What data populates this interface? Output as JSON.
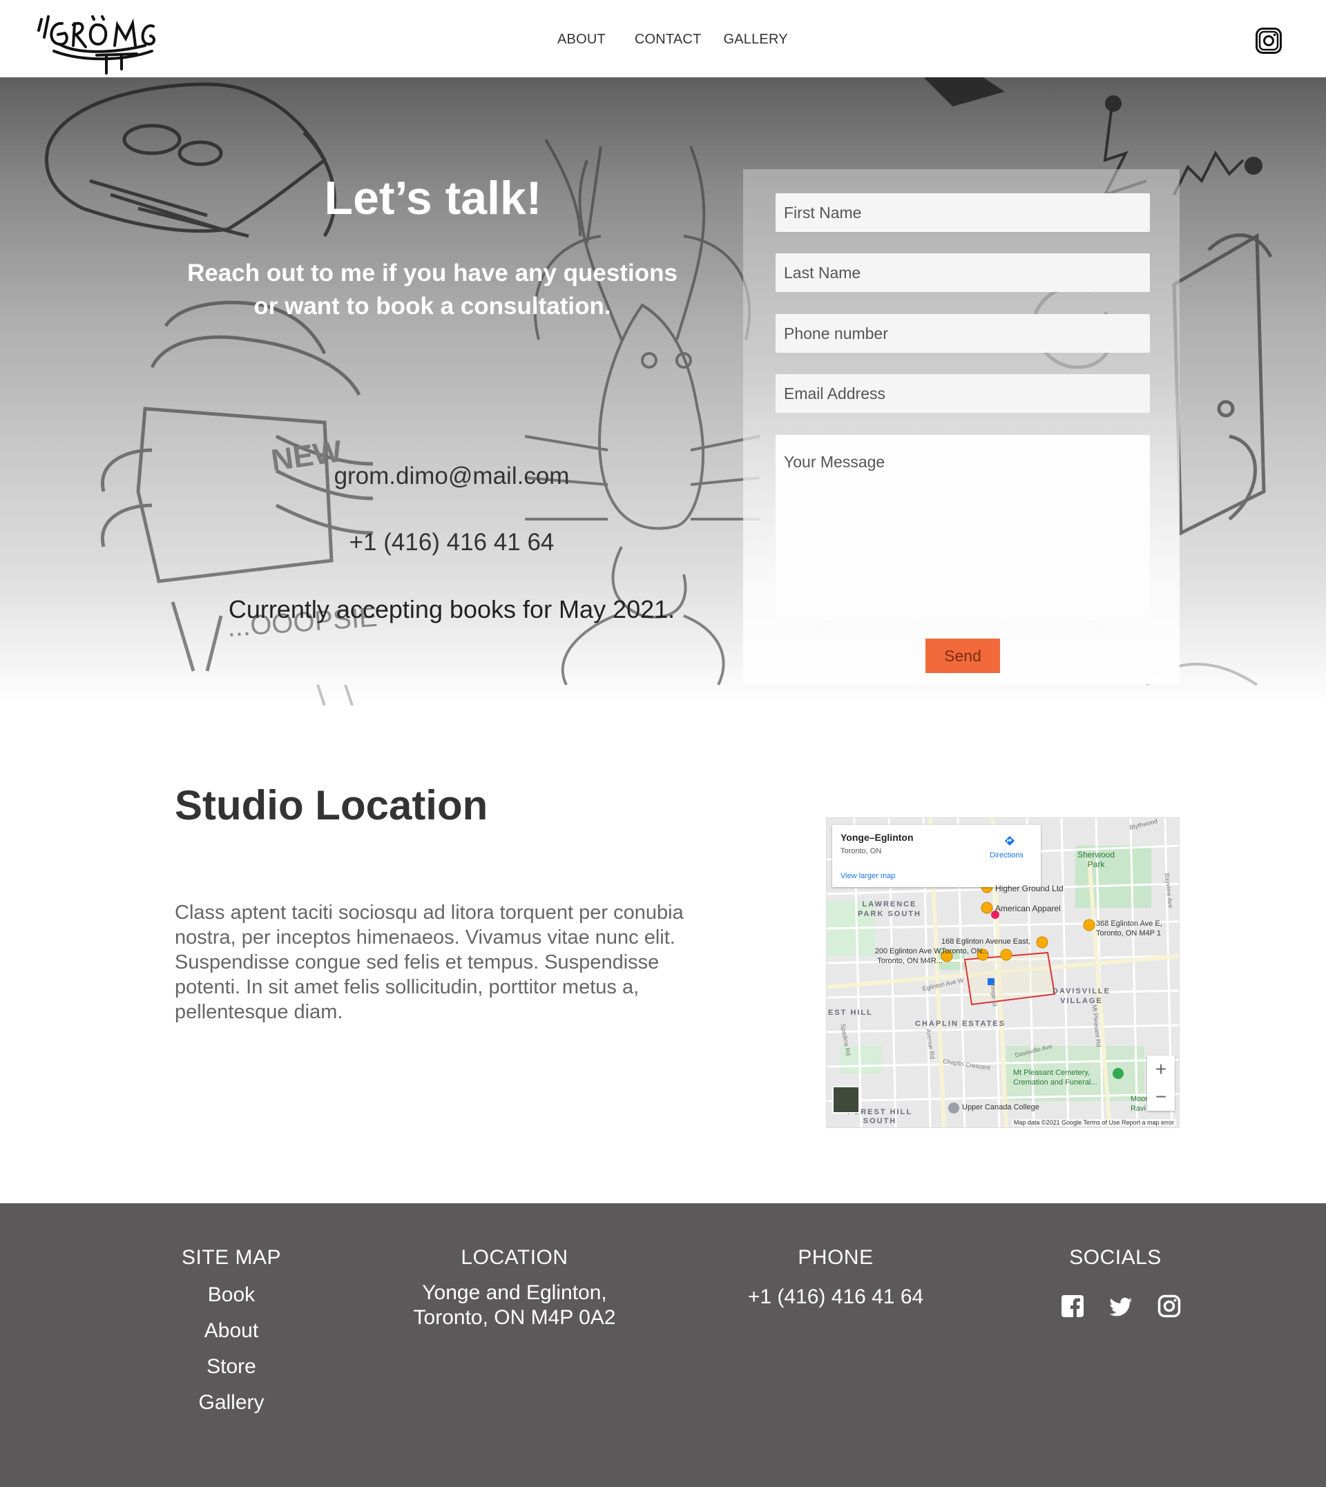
{
  "nav": {
    "logo_alt": "GROMG",
    "links": [
      "ABOUT",
      "CONTACT",
      "GALLERY"
    ],
    "instagram_icon": "instagram-icon"
  },
  "hero": {
    "title": "Let’s talk!",
    "subtitle": "Reach out to me if you have any questions or want to book a consultation.",
    "email": "grom.dimo@mail.com",
    "phone": "+1 (416) 416 41 64",
    "note": "Currently accepting books for May 2021."
  },
  "form": {
    "first_name_placeholder": "First Name",
    "last_name_placeholder": "Last Name",
    "phone_placeholder": "Phone number",
    "email_placeholder": "Email Address",
    "message_placeholder": "Your Message",
    "send_label": "Send",
    "send_color": "#f26a3c"
  },
  "location": {
    "title": "Studio Location",
    "body": "Class aptent taciti sociosqu ad litora torquent per conubia nostra, per inceptos himenaeos. Vivamus vitae nunc elit. Suspendisse congue sed felis et tempus. Suspendisse potenti. In sit amet felis sollicitudin, porttitor metus a, pellentesque diam."
  },
  "map": {
    "card_title": "Yonge–Eglinton",
    "card_subtitle": "Toronto, ON",
    "directions": "Directions",
    "larger_map": "View larger map",
    "labels": {
      "sherwood": "Sherwood Park",
      "lawrence": "LAWRENCE PARK SOUTH",
      "higher_ground": "Higher Ground Ltd",
      "american_apparel": "American Apparel",
      "eglinton_368": "368 Eglinton Ave E, Toronto, ON M4P 1",
      "eglinton_168": "168 Eglinton Avenue East, Toronto, ON...",
      "eglinton_200": "200 Eglinton Ave W, Toronto, ON M4R...",
      "davisville": "DAVISVILLE VILLAGE",
      "chaplin": "CHAPLIN ESTATES",
      "forest_hill": "FOREST HILL SOUTH",
      "est_hill": "EST HILL",
      "mt_pleasant": "Mt Pleasant Cemetery, Cremation and Funeral...",
      "upper_canada": "Upper Canada College",
      "moore": "Moore Ravi",
      "eglinton_ave_w": "Eglinton Ave W",
      "davisville_ave": "Davisville Ave",
      "chaplin_cres": "Chaplin Crescent",
      "spadina": "Spadina Rd",
      "avenue_rd": "Avenue Rd",
      "yonge": "Yonge St",
      "mt_pleasant_rd": "Mt Pleasant Rd",
      "bayview": "Bayview Ave",
      "blythwood": "Blythwood"
    },
    "footer": "Map data ©2021 Google   Terms of Use   Report a map error",
    "zoom_in": "+",
    "zoom_out": "−"
  },
  "footer": {
    "sitemap_title": "SITE MAP",
    "sitemap_links": [
      "Book",
      "About",
      "Store",
      "Gallery"
    ],
    "location_title": "LOCATION",
    "location_line1": "Yonge and Eglinton,",
    "location_line2": "Toronto, ON M4P 0A2",
    "phone_title": "PHONE",
    "phone": "+1 (416) 416 41 64",
    "socials_title": "SOCIALS",
    "social_icons": [
      "facebook-icon",
      "twitter-icon",
      "instagram-icon"
    ],
    "bg_color": "#5c595a"
  }
}
